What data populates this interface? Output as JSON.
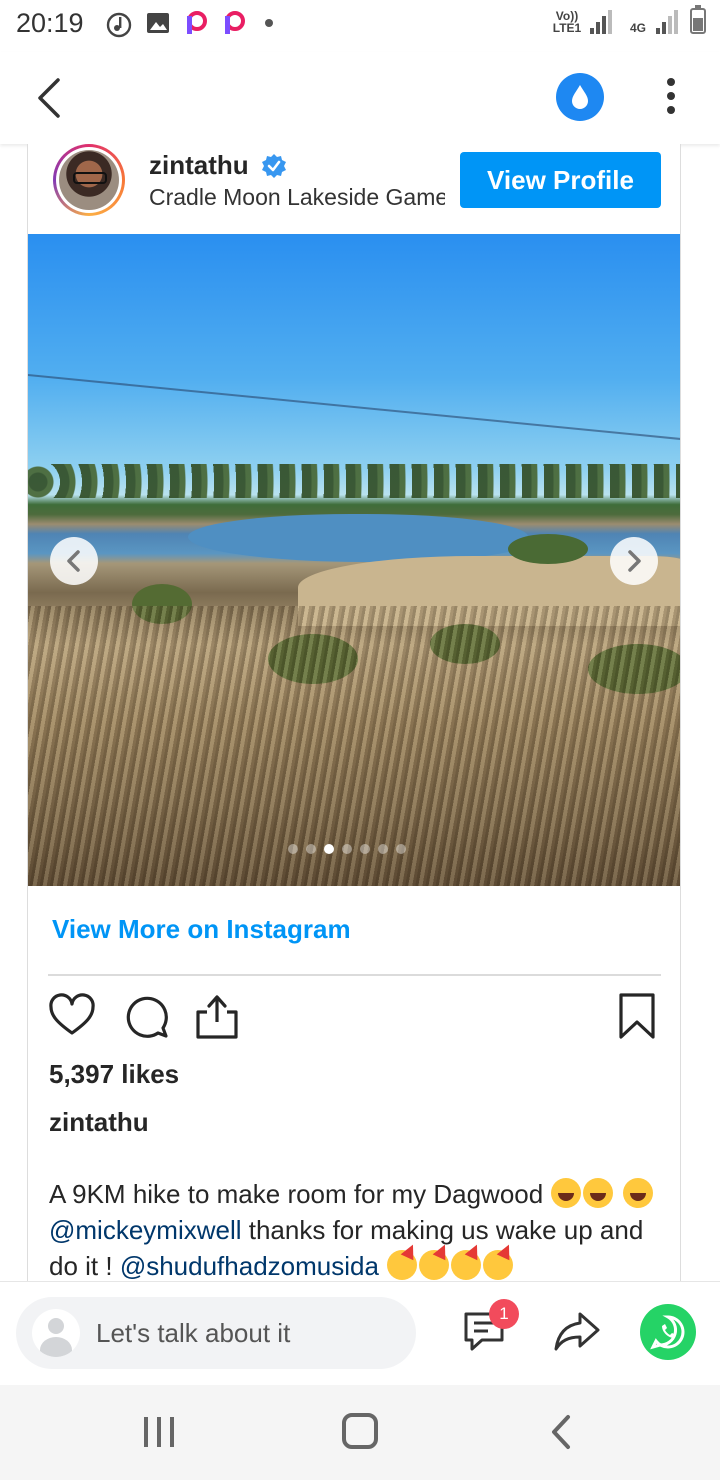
{
  "status_bar": {
    "time": "20:19",
    "network_label_1": "Vo)) LTE1",
    "network_label_2": "4G",
    "notification_icons": [
      "music-sync-icon",
      "gallery-icon",
      "p-app-icon",
      "p-app-icon",
      "dot-icon"
    ]
  },
  "app_bar": {
    "back_icon": "chevron-left-icon",
    "action_icon": "water-drop-icon",
    "menu_icon": "more-vertical-icon"
  },
  "post": {
    "username": "zintathu",
    "verified": true,
    "location": "Cradle Moon Lakeside Game Reserve",
    "view_profile_label": "View Profile",
    "carousel": {
      "slide_count": 7,
      "active_slide": 3
    },
    "view_more_label": "View More on Instagram",
    "likes": "5,397 likes",
    "caption_user": "zintathu",
    "caption": {
      "part1": "A 9KM hike to make room for my Dagwood",
      "mention1": "@mickeymixwell",
      "part2": "thanks for making us wake up and do it !",
      "mention2": "@shudufhadzomusida"
    }
  },
  "comment_bar": {
    "placeholder": "Let's talk about it",
    "message_badge": "1"
  },
  "colors": {
    "instagram_blue": "#0095f6",
    "app_blue": "#1e88f2",
    "whatsapp_green": "#25d366",
    "badge_red": "#f24b5c"
  }
}
